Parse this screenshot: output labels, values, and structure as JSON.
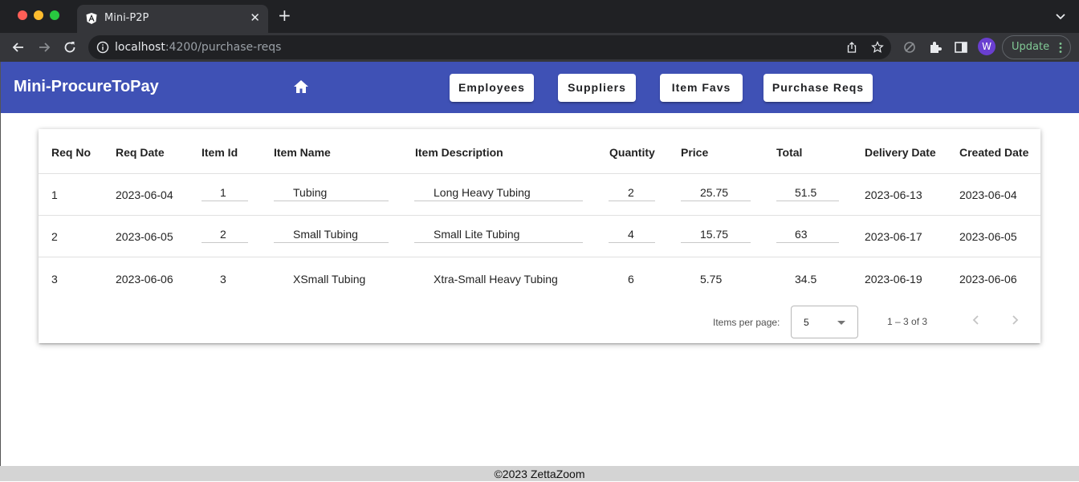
{
  "browser": {
    "tab_title": "Mini-P2P",
    "new_tab_label": "+",
    "tab_close_label": "✕",
    "url_host": "localhost",
    "url_rest": ":4200/purchase-reqs",
    "profile_initial": "W",
    "update_label": "Update"
  },
  "header": {
    "app_title": "Mini-ProcureToPay",
    "nav": [
      "Employees",
      "Suppliers",
      "Item Favs",
      "Purchase Reqs"
    ],
    "brand_color": "#3f51b5"
  },
  "table": {
    "columns": [
      "Req No",
      "Req Date",
      "Item Id",
      "Item Name",
      "Item Description",
      "Quantity",
      "Price",
      "Total",
      "Delivery Date",
      "Created Date"
    ],
    "rows": [
      {
        "req_no": "1",
        "req_date": "2023-06-04",
        "item_id": "1",
        "item_name": "Tubing",
        "item_description": "Long Heavy Tubing",
        "quantity": "2",
        "price": "25.75",
        "total": "51.5",
        "delivery_date": "2023-06-13",
        "created_date": "2023-06-04"
      },
      {
        "req_no": "2",
        "req_date": "2023-06-05",
        "item_id": "2",
        "item_name": "Small Tubing",
        "item_description": "Small Lite Tubing",
        "quantity": "4",
        "price": "15.75",
        "total": "63",
        "delivery_date": "2023-06-17",
        "created_date": "2023-06-05"
      },
      {
        "req_no": "3",
        "req_date": "2023-06-06",
        "item_id": "3",
        "item_name": "XSmall Tubing",
        "item_description": "Xtra-Small Heavy Tubing",
        "quantity": "6",
        "price": "5.75",
        "total": "34.5",
        "delivery_date": "2023-06-19",
        "created_date": "2023-06-06"
      }
    ]
  },
  "paginator": {
    "items_per_page_label": "Items per page:",
    "page_size": "5",
    "range_label": "1 – 3 of 3"
  },
  "footer": {
    "text": "©2023 ZettaZoom"
  }
}
